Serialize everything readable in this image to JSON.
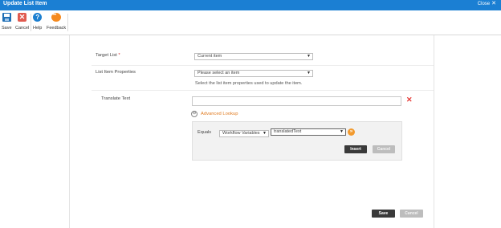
{
  "window": {
    "title": "Update List Item",
    "close_label": "Close"
  },
  "toolbar": {
    "save_label": "Save",
    "cancel_label": "Cancel",
    "help_label": "Help",
    "feedback_label": "Feedback"
  },
  "form": {
    "target_list": {
      "label": "Target List",
      "required_marker": "*",
      "value": "Current item"
    },
    "list_item_properties": {
      "label": "List Item Properties",
      "value": "Please select an item",
      "help_text": "Select the list item properties used to update the item."
    },
    "translate_text": {
      "label": "Translate Text",
      "value": ""
    },
    "advanced_lookup": {
      "toggle_symbol": "⊖",
      "label": "Advanced Lookup",
      "operator": "Equals",
      "source": "Workflow Variables",
      "variable": "translatedText",
      "insert_label": "Insert",
      "cancel_label": "Cancel"
    }
  },
  "footer": {
    "save_label": "Save",
    "cancel_label": "Cancel"
  },
  "colors": {
    "titlebar": "#1b7fd3",
    "accent_orange": "#e07a1f",
    "error_red": "#e53935"
  }
}
